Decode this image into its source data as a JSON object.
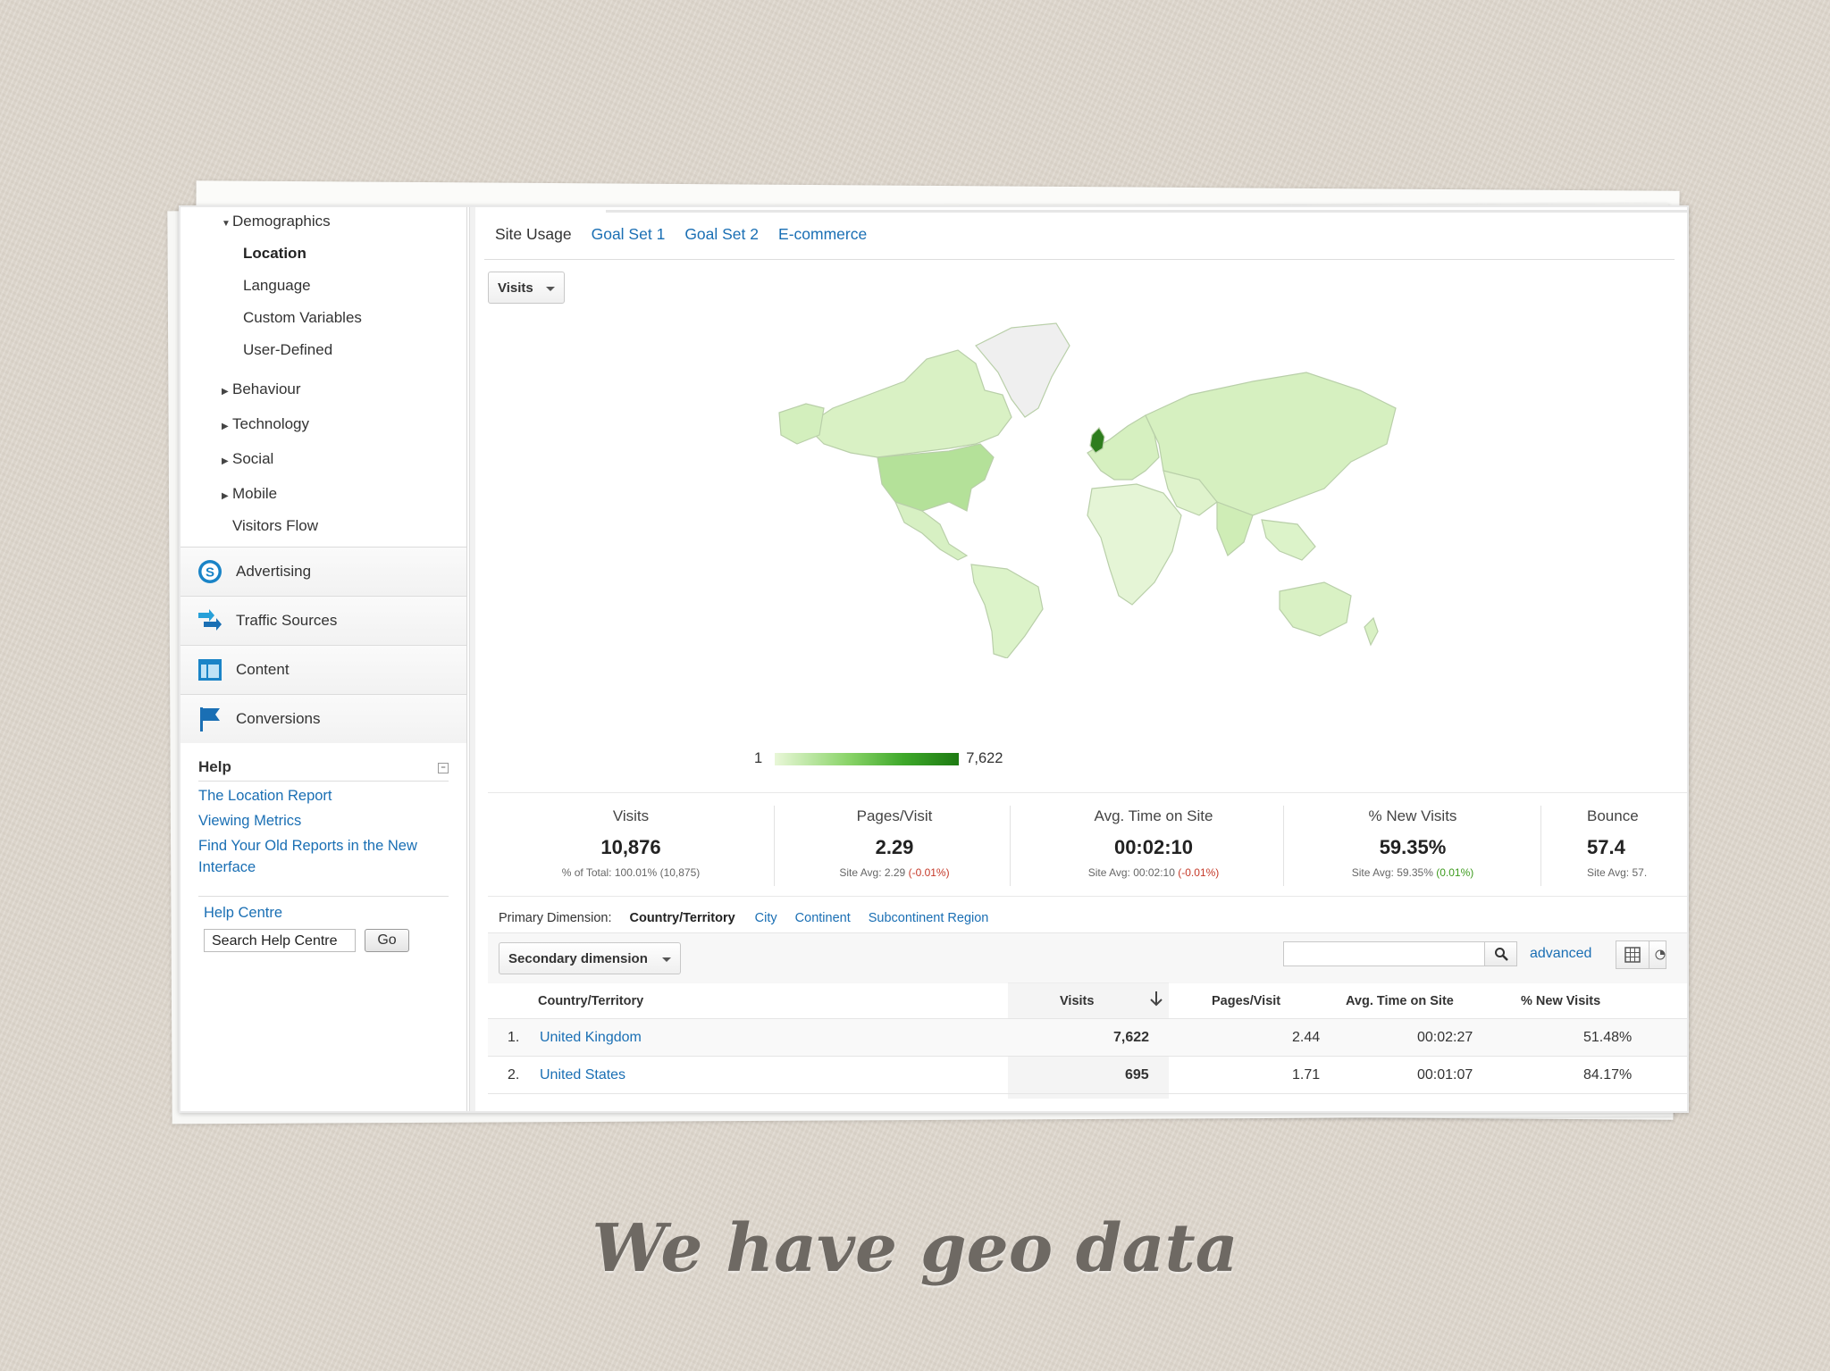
{
  "sidebar": {
    "demographics": "Demographics",
    "demographics_items": [
      "Location",
      "Language",
      "Custom Variables",
      "User-Defined"
    ],
    "behaviour": "Behaviour",
    "technology": "Technology",
    "social": "Social",
    "mobile": "Mobile",
    "visitors_flow": "Visitors Flow",
    "sections": {
      "advertising": "Advertising",
      "traffic_sources": "Traffic Sources",
      "content": "Content",
      "conversions": "Conversions"
    },
    "help": {
      "title": "Help",
      "links": [
        "The Location Report",
        "Viewing Metrics",
        "Find Your Old Reports in the New Interface"
      ],
      "help_centre": "Help Centre",
      "search_value": "Search Help Centre",
      "go": "Go"
    }
  },
  "tabs": [
    "Site Usage",
    "Goal Set 1",
    "Goal Set 2",
    "E-commerce"
  ],
  "metric_select": "Visits",
  "legend": {
    "min": "1",
    "max": "7,622"
  },
  "scorecards": [
    {
      "title": "Visits",
      "value": "10,876",
      "sub_prefix": "% of Total: 100.01%",
      "sub_delta": "(10,875)",
      "delta_class": "plain"
    },
    {
      "title": "Pages/Visit",
      "value": "2.29",
      "sub_prefix": "Site Avg: 2.29",
      "sub_delta": "(-0.01%)",
      "delta_class": "neg"
    },
    {
      "title": "Avg. Time on Site",
      "value": "00:02:10",
      "sub_prefix": "Site Avg: 00:02:10",
      "sub_delta": "(-0.01%)",
      "delta_class": "neg"
    },
    {
      "title": "% New Visits",
      "value": "59.35%",
      "sub_prefix": "Site Avg: 59.35%",
      "sub_delta": "(0.01%)",
      "delta_class": "pos"
    },
    {
      "title": "Bounce",
      "value": "57.4",
      "sub_prefix": "Site Avg: 57.",
      "sub_delta": "",
      "delta_class": "plain"
    }
  ],
  "dimensions": {
    "label": "Primary Dimension:",
    "current": "Country/Territory",
    "options": [
      "City",
      "Continent",
      "Subcontinent Region"
    ]
  },
  "secondary_dimension": "Secondary dimension",
  "advanced": "advanced",
  "table": {
    "headers": {
      "name": "Country/Territory",
      "visits": "Visits",
      "pages": "Pages/Visit",
      "time": "Avg. Time on Site",
      "new": "% New Visits"
    },
    "rows": [
      {
        "rank": "1.",
        "name": "United Kingdom",
        "visits": "7,622",
        "pages": "2.44",
        "time": "00:02:27",
        "new": "51.48%"
      },
      {
        "rank": "2.",
        "name": "United States",
        "visits": "695",
        "pages": "1.71",
        "time": "00:01:07",
        "new": "84.17%"
      }
    ]
  },
  "caption": "We have geo data",
  "colors": {
    "link": "#1a6fb4",
    "map_low": "#e9f7d8",
    "map_high": "#1d7a12",
    "negative": "#c53929",
    "positive": "#3e9b1f"
  }
}
